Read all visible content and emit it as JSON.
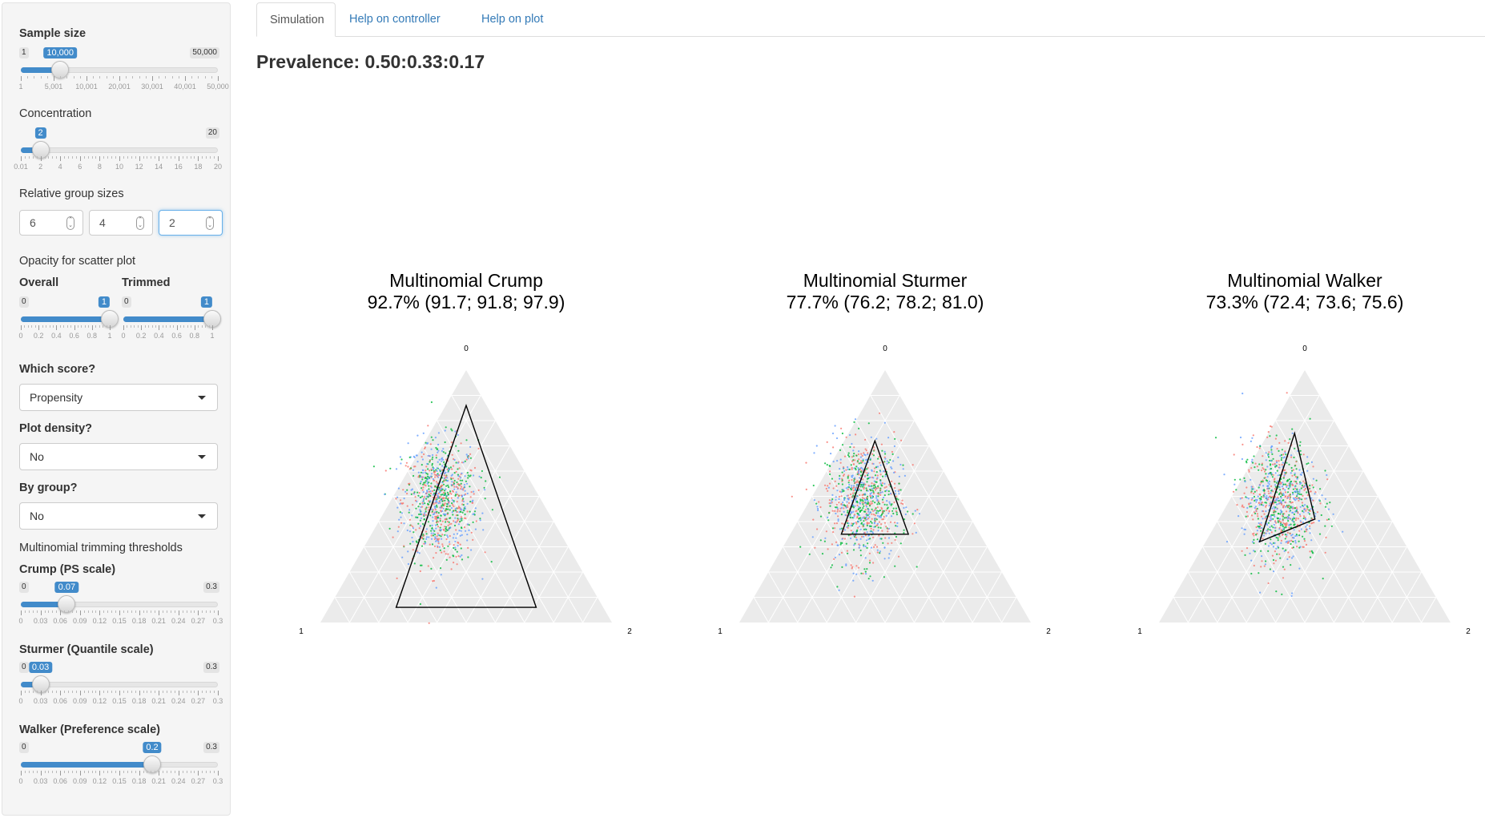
{
  "sidebar": {
    "sample_size": {
      "label": "Sample size",
      "min": "1",
      "max": "50,000",
      "value": "10,000",
      "fraction": 0.2,
      "ticks": [
        "1",
        "5,001",
        "10,001",
        "20,001",
        "30,001",
        "40,001",
        "50,000"
      ]
    },
    "concentration": {
      "label": "Concentration",
      "min": "0.01",
      "max": "20",
      "value": "2",
      "fraction": 0.1,
      "max_label": "20",
      "ticks": [
        "0.01",
        "2",
        "4",
        "6",
        "8",
        "10",
        "12",
        "14",
        "16",
        "18",
        "20"
      ]
    },
    "group_sizes": {
      "label": "Relative group sizes",
      "values": [
        "6",
        "4",
        "2"
      ]
    },
    "opacity": {
      "label": "Opacity for scatter plot",
      "overall": {
        "label": "Overall",
        "min": "0",
        "value": "1",
        "fraction": 1.0,
        "ticks": [
          "0",
          "0.2",
          "0.4",
          "0.6",
          "0.8",
          "1"
        ]
      },
      "trimmed": {
        "label": "Trimmed",
        "min": "0",
        "value": "1",
        "fraction": 1.0,
        "ticks": [
          "0",
          "0.2",
          "0.4",
          "0.6",
          "0.8",
          "1"
        ]
      }
    },
    "which_score": {
      "label": "Which score?",
      "value": "Propensity"
    },
    "plot_density": {
      "label": "Plot density?",
      "value": "No"
    },
    "by_group": {
      "label": "By group?",
      "value": "No"
    },
    "thresholds_label": "Multinomial trimming thresholds",
    "crump": {
      "label": "Crump (PS scale)",
      "min": "0",
      "max": "0.3",
      "value": "0.07",
      "fraction": 0.2333,
      "ticks": [
        "0",
        "0.03",
        "0.06",
        "0.09",
        "0.12",
        "0.15",
        "0.18",
        "0.21",
        "0.24",
        "0.27",
        "0.3"
      ]
    },
    "sturmer": {
      "label": "Sturmer (Quantile scale)",
      "min": "0",
      "max": "0.3",
      "value": "0.03",
      "fraction": 0.1,
      "ticks": [
        "0",
        "0.03",
        "0.06",
        "0.09",
        "0.12",
        "0.15",
        "0.18",
        "0.21",
        "0.24",
        "0.27",
        "0.3"
      ]
    },
    "walker": {
      "label": "Walker (Preference scale)",
      "min": "0",
      "max": "0.3",
      "value": "0.2",
      "fraction": 0.6667,
      "ticks": [
        "0",
        "0.03",
        "0.06",
        "0.09",
        "0.12",
        "0.15",
        "0.18",
        "0.21",
        "0.24",
        "0.27",
        "0.3"
      ]
    }
  },
  "tabs": [
    "Simulation",
    "Help on controller",
    "Help on plot"
  ],
  "prevalence": "Prevalence: 0.50:0.33:0.17",
  "plots": [
    {
      "title": "Multinomial Crump",
      "subtitle": "92.7% (91.7; 91.8; 97.9)",
      "corner_top": "0",
      "corner_left": "1",
      "corner_right": "2"
    },
    {
      "title": "Multinomial Sturmer",
      "subtitle": "77.7% (76.2; 78.2; 81.0)",
      "corner_top": "0",
      "corner_left": "1",
      "corner_right": "2"
    },
    {
      "title": "Multinomial Walker",
      "subtitle": "73.3% (72.4; 73.6; 75.6)",
      "corner_top": "0",
      "corner_left": "1",
      "corner_right": "2"
    }
  ],
  "colors": {
    "accent": "#428bca",
    "point_red": "#f8766d",
    "point_green": "#00ba38",
    "point_blue": "#619cff",
    "panel": "#ebebeb"
  }
}
